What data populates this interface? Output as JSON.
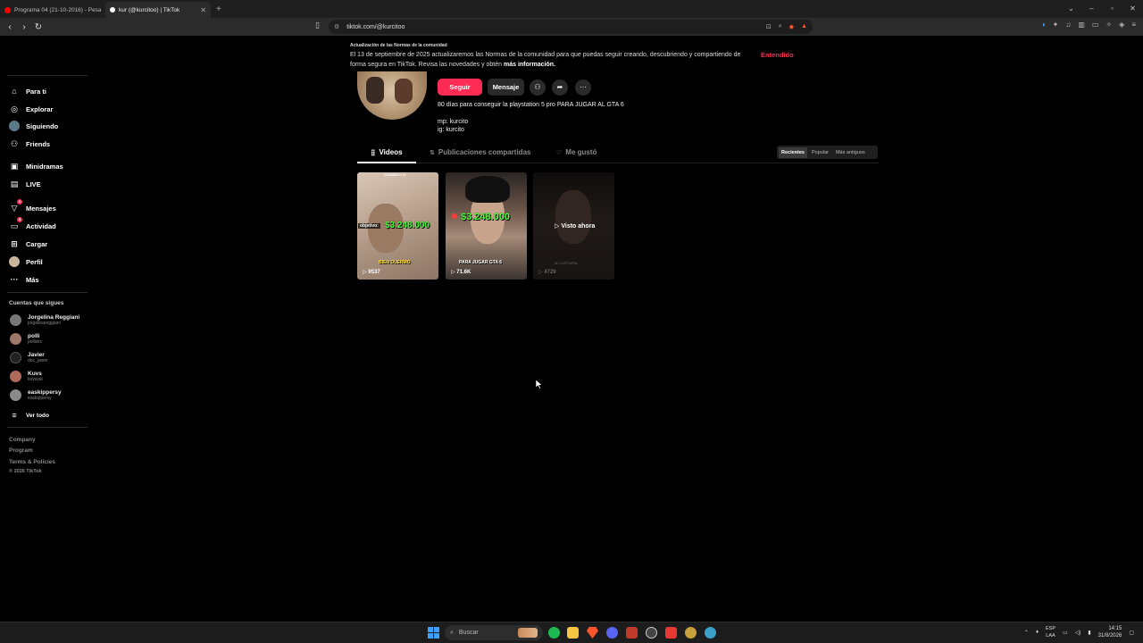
{
  "browser": {
    "tabs": [
      {
        "title": "Programa 04 (21-10-2016) - Pesadill",
        "favicon_color": "#ff0000"
      },
      {
        "title": "kur (@kurcitoo) | TikTok",
        "favicon_color": "#ffffff"
      }
    ],
    "new_tab": "+",
    "url": "tiktok.com/@kurcitoo"
  },
  "sidebar": {
    "nav": [
      {
        "label": "Para ti",
        "icon": "home-icon",
        "glyph": "⌂"
      },
      {
        "label": "Explorar",
        "icon": "compass-icon",
        "glyph": "◎"
      },
      {
        "label": "Siguiendo",
        "icon": "following-avatar-icon",
        "glyph": "●"
      },
      {
        "label": "Friends",
        "icon": "friends-icon",
        "glyph": "⚇"
      },
      {
        "label": "Minidramas",
        "icon": "minidramas-icon",
        "glyph": "▣"
      },
      {
        "label": "LIVE",
        "icon": "live-icon",
        "glyph": "▤"
      },
      {
        "label": "Mensajes",
        "icon": "messages-icon",
        "glyph": "▽",
        "badge": "1"
      },
      {
        "label": "Actividad",
        "icon": "activity-icon",
        "glyph": "▭",
        "badge": "4"
      },
      {
        "label": "Cargar",
        "icon": "upload-icon",
        "glyph": "⊞"
      },
      {
        "label": "Perfil",
        "icon": "profile-avatar-icon",
        "glyph": "●"
      },
      {
        "label": "Más",
        "icon": "more-icon",
        "glyph": "···"
      }
    ],
    "following_title": "Cuentas que sigues",
    "following": [
      {
        "name": "Jorgelina Reggiani",
        "user": "jorgelinareggiani"
      },
      {
        "name": "polli",
        "user": "pollidrs"
      },
      {
        "name": "Javier",
        "user": "doc_javier"
      },
      {
        "name": "Kuvs",
        "user": "kuvsval"
      },
      {
        "name": "easkippersy",
        "user": "easkippersy"
      }
    ],
    "see_all": "Ver todo",
    "footer": [
      "Company",
      "Program",
      "Terms & Policies"
    ],
    "copyright": "© 2026 TikTok"
  },
  "notice": {
    "title": "Actualización de las Normas de la comunidad",
    "body": "El 13 de septiembre de 2025 actualizaremos las Normas de la comunidad para que puedas seguir creando, descubriendo y compartiendo de forma segura en TikTok. Revisa las novedades y obtén",
    "link": "más información.",
    "dismiss": "Entendido"
  },
  "profile": {
    "follow": "Seguir",
    "message": "Mensaje",
    "bio": "80 días para conseguir la playstation 5 pro PARA JUGAR AL GTA 6",
    "bio_mp": "mp: kurcito",
    "bio_ig": "ig: kurcito"
  },
  "tabs": {
    "videos": "Videos",
    "reposts": "Publicaciones compartidas",
    "liked": "Me gustó"
  },
  "sort": {
    "recent": "Recientes",
    "popular": "Popular",
    "oldest": "Más antiguos"
  },
  "videos": [
    {
      "top": "CUANDO LO",
      "money": "$3.248.000",
      "prefix": "objetivo:",
      "caption": "BIEN DUERMO",
      "views": "9537"
    },
    {
      "money": "$3.248.000",
      "caption": "PARA JUGAR GTA 6",
      "views": "71.6K"
    },
    {
      "watched": "Visto ahora",
      "caption": "MI GUSTARÍA",
      "views": "4729"
    }
  ],
  "taskbar": {
    "search": "Buscar",
    "lang_top": "ESP",
    "lang_bottom": "LAA",
    "time": "14:15",
    "date": "31/8/2026"
  }
}
